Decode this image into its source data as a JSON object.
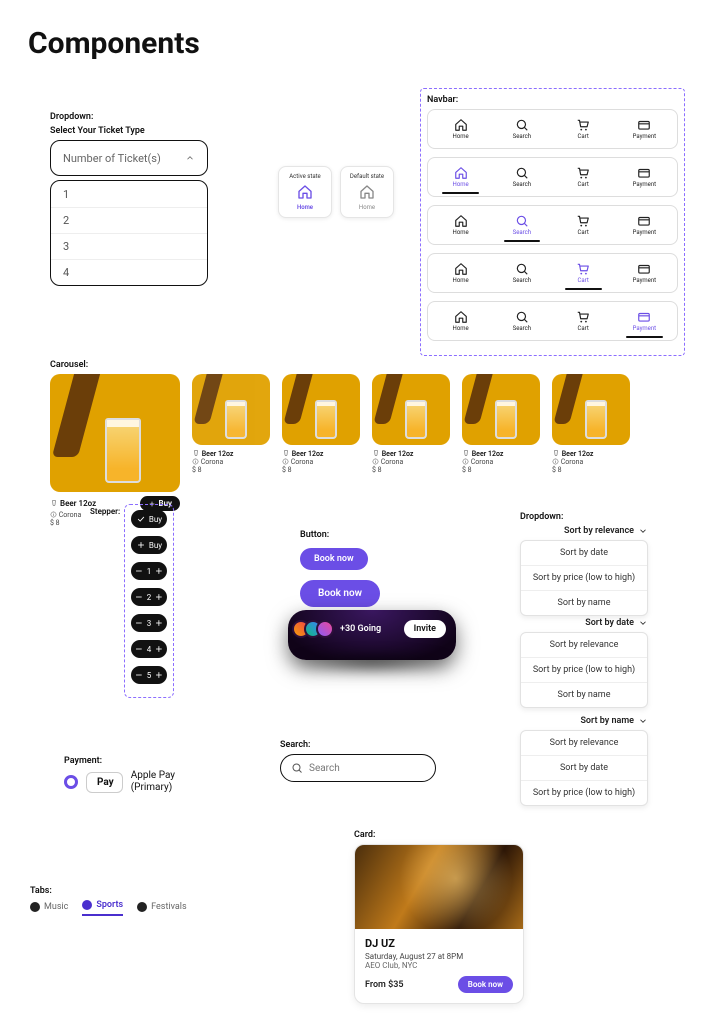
{
  "page_title": "Components",
  "dropdown": {
    "section_label": "Dropdown:",
    "title": "Select Your Ticket Type",
    "placeholder": "Number of Ticket(s)",
    "options": [
      "1",
      "2",
      "3",
      "4"
    ]
  },
  "state_cards": {
    "active": {
      "title": "Active state",
      "label": "Home"
    },
    "default": {
      "title": "Default state",
      "label": "Home"
    }
  },
  "navbar": {
    "section_label": "Navbar:",
    "items": [
      {
        "label": "Home"
      },
      {
        "label": "Search"
      },
      {
        "label": "Cart"
      },
      {
        "label": "Payment"
      }
    ],
    "rows": [
      {
        "active": null
      },
      {
        "active": 0
      },
      {
        "active": 1
      },
      {
        "active": 2
      },
      {
        "active": 3
      }
    ]
  },
  "carousel": {
    "section_label": "Carousel:",
    "product": {
      "name": "Beer 12oz",
      "brand": "Corona",
      "price": "$ 8",
      "buy": "Buy"
    },
    "count": 6
  },
  "stepper": {
    "section_label": "Stepper:",
    "buy_checked": "Buy",
    "buy_plus": "Buy",
    "values": [
      "1",
      "2",
      "3",
      "4",
      "5"
    ]
  },
  "button": {
    "section_label": "Button:",
    "label": "Book now"
  },
  "going": {
    "count_label": "+30 Going",
    "invite": "Invite"
  },
  "sort": {
    "section_label": "Dropdown:",
    "sets": [
      {
        "selected": "Sort by relevance",
        "options": [
          "Sort by date",
          "Sort by price (low to high)",
          "Sort by name"
        ]
      },
      {
        "selected": "Sort by date",
        "options": [
          "Sort by relevance",
          "Sort by price (low to high)",
          "Sort by name"
        ]
      },
      {
        "selected": "Sort by name",
        "options": [
          "Sort by relevance",
          "Sort by date",
          "Sort by price (low to high)"
        ]
      }
    ]
  },
  "search": {
    "section_label": "Search:",
    "placeholder": "Search"
  },
  "payment": {
    "section_label": "Payment:",
    "logo": "Pay",
    "label_line1": "Apple Pay",
    "label_line2": "(Primary)"
  },
  "tabs": {
    "section_label": "Tabs:",
    "items": [
      {
        "label": "Music",
        "active": false
      },
      {
        "label": "Sports",
        "active": true
      },
      {
        "label": "Festivals",
        "active": false
      }
    ]
  },
  "card": {
    "section_label": "Card:",
    "title": "DJ UZ",
    "date": "Saturday, August 27 at 8PM",
    "location": "AEO Club, NYC",
    "price": "From $35",
    "button": "Book now"
  }
}
